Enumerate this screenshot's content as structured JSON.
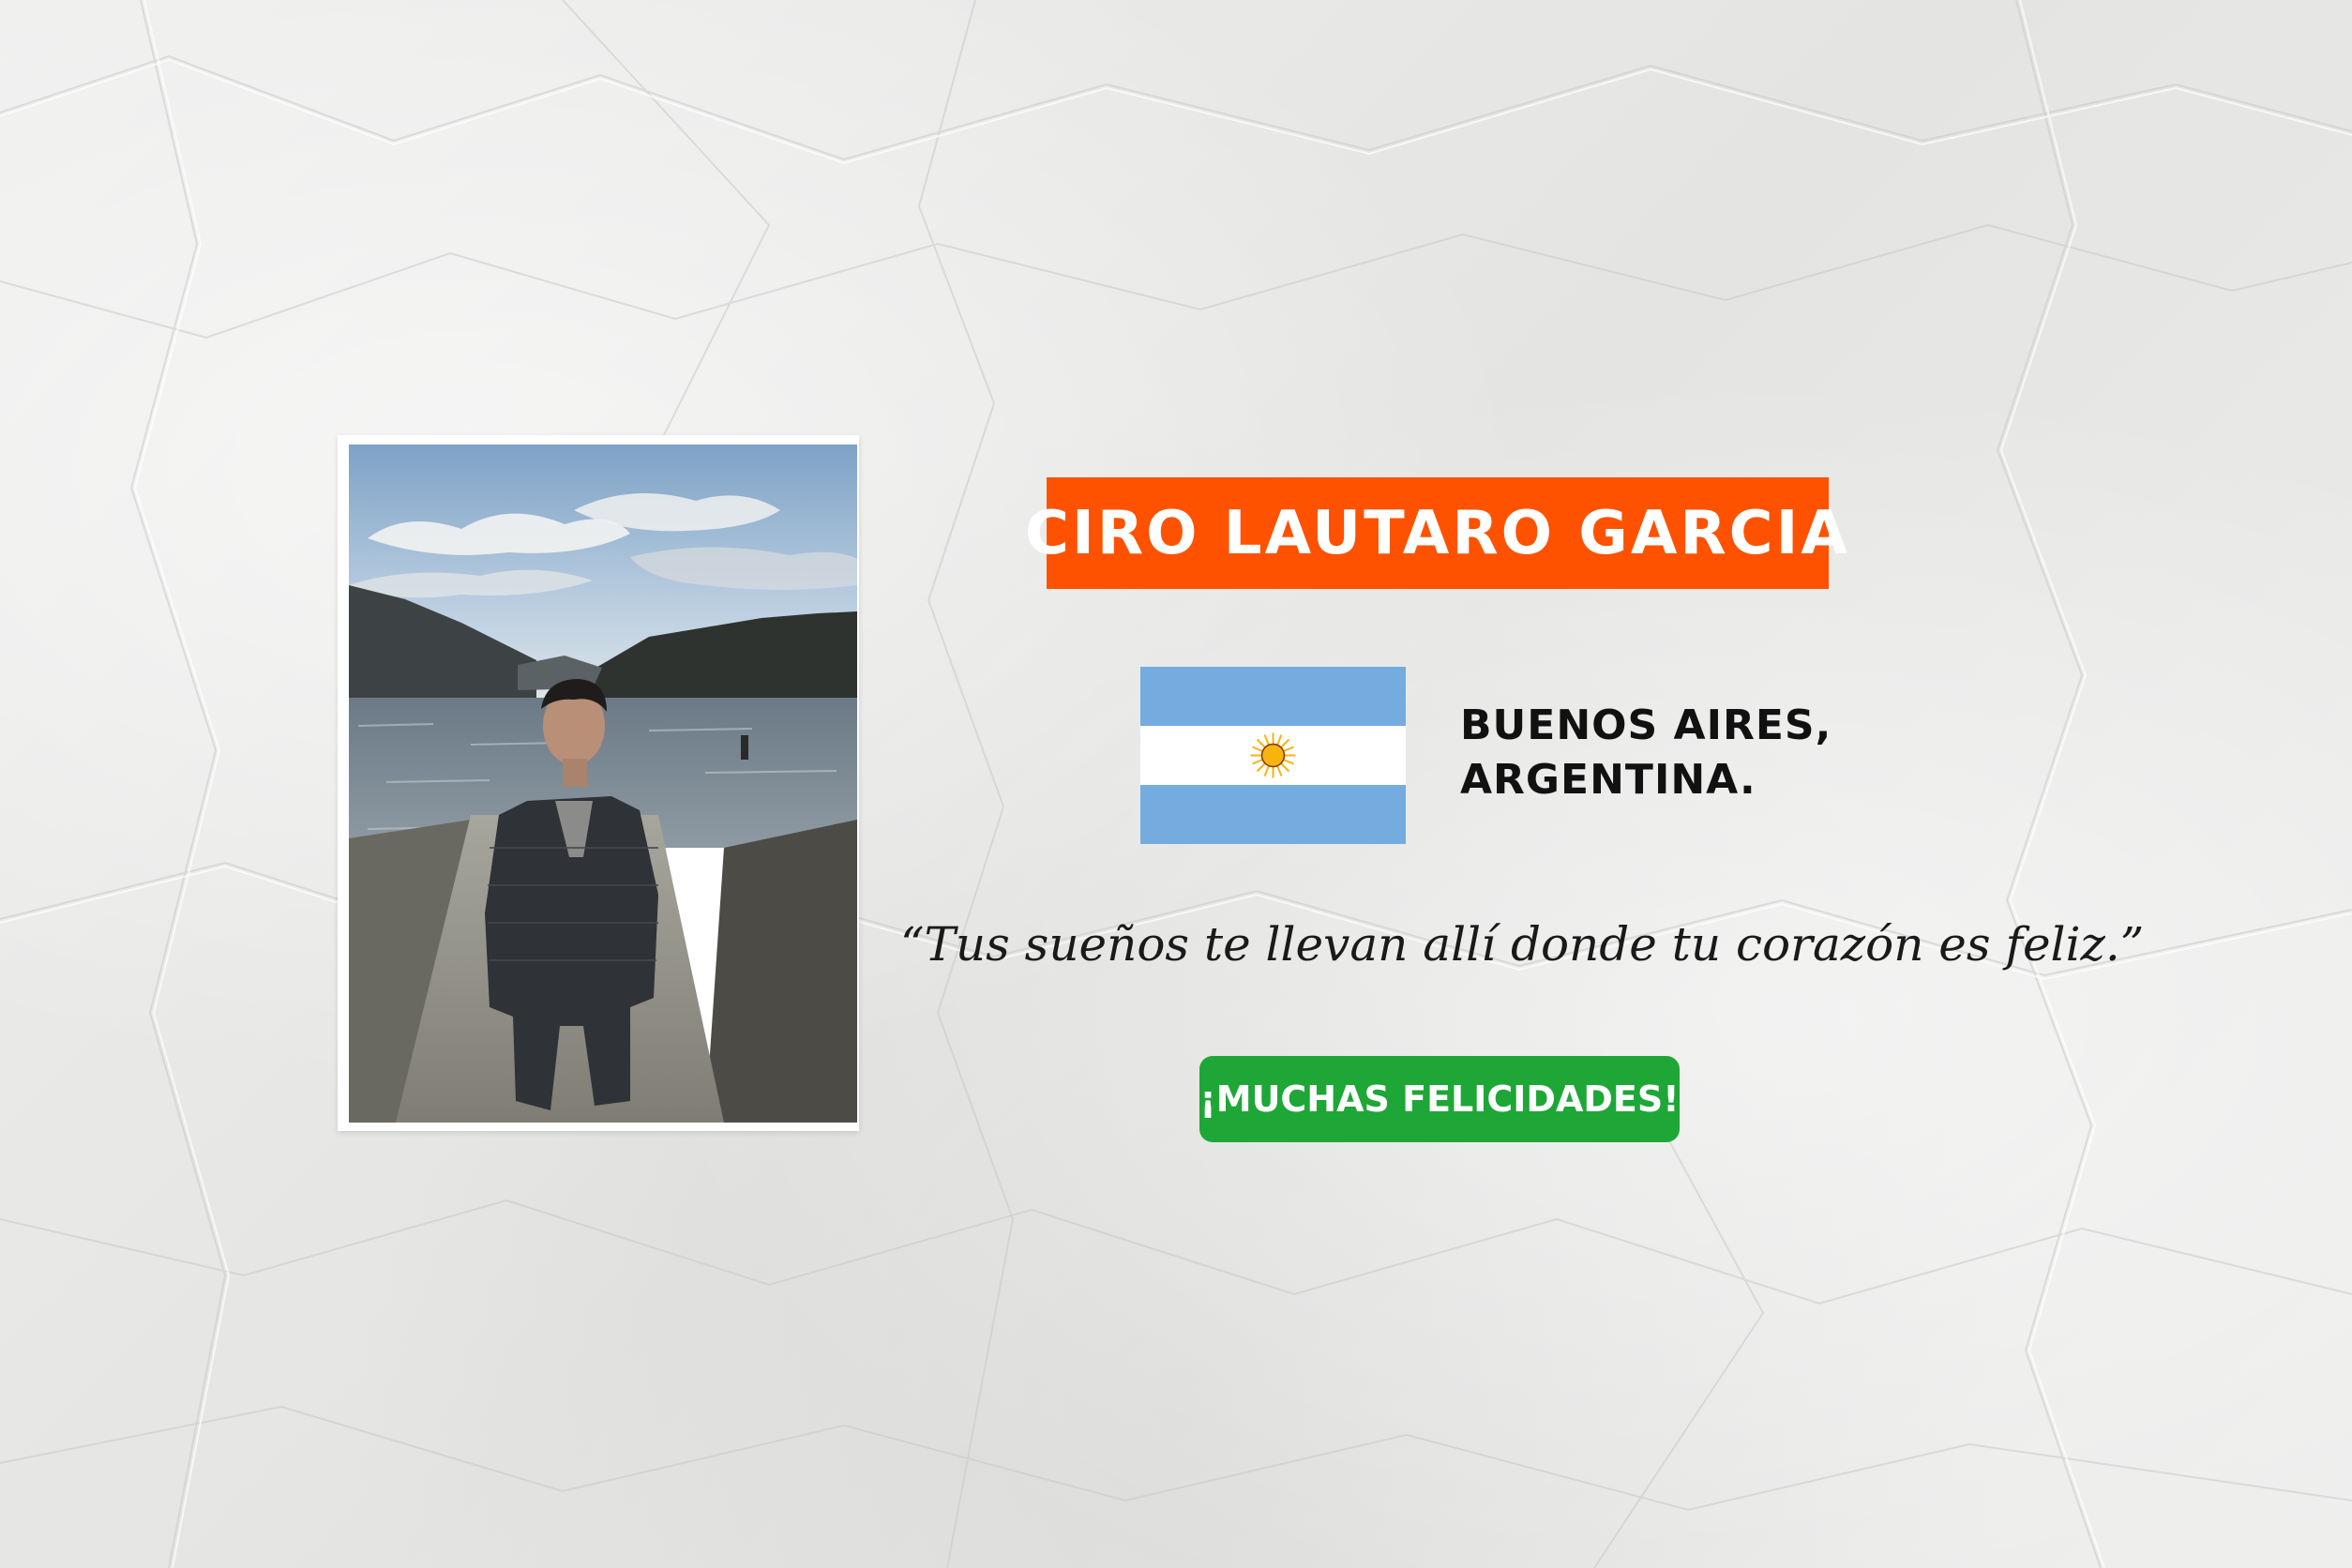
{
  "card": {
    "name": "CIRO LAUTARO GARCIA",
    "location_line1": "BUENOS AIRES,",
    "location_line2": "ARGENTINA.",
    "quote": "“Tus sueños te llevan allí donde tu corazón es feliz.”",
    "congrats": "¡MUCHAS FELICIDADES!"
  },
  "colors": {
    "name_banner": "#fe5200",
    "congrats_badge": "#1ea737",
    "flag_blue": "#74acdf",
    "flag_white": "#ffffff",
    "flag_sun": "#f6b40e"
  },
  "icons": {
    "flag": "argentina-flag",
    "photo": "portrait-photo"
  }
}
